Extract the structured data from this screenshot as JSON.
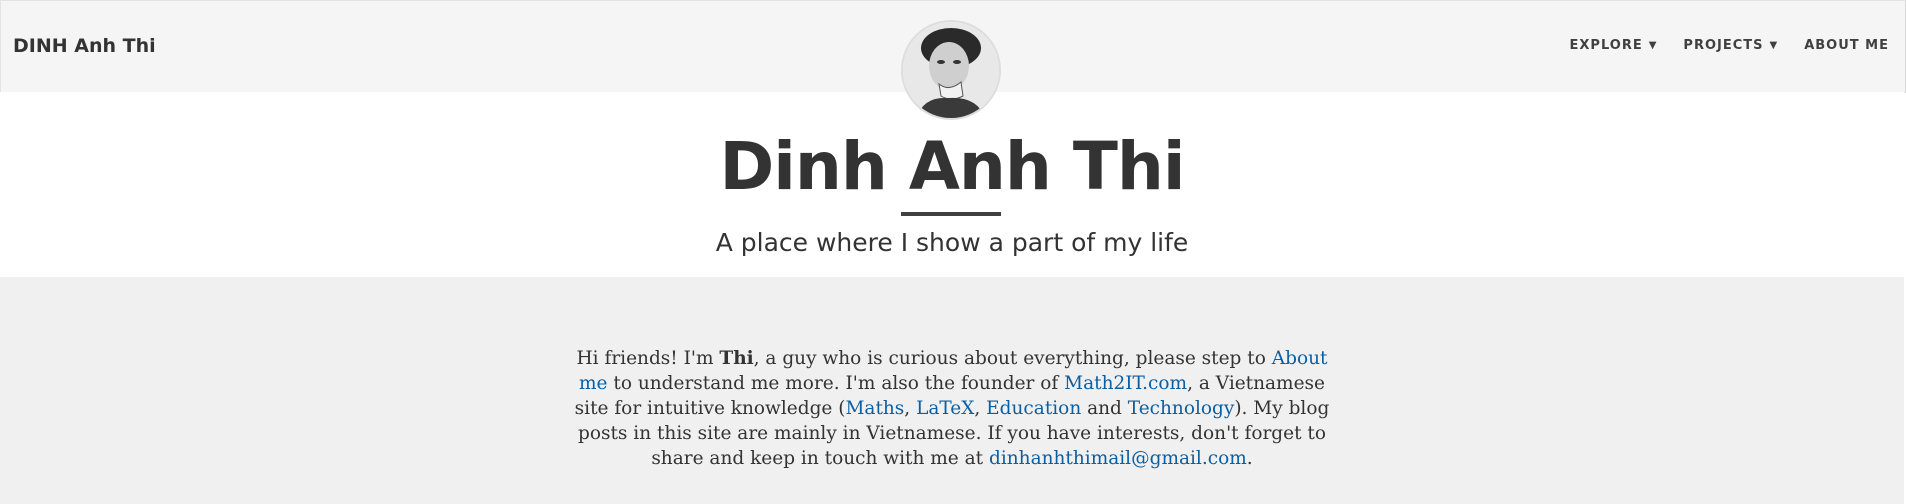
{
  "navbar": {
    "brand": "DINH Anh Thi",
    "links": [
      {
        "label": "EXPLORE",
        "caret": "▼"
      },
      {
        "label": "PROJECTS",
        "caret": "▼"
      },
      {
        "label": "ABOUT ME",
        "caret": ""
      }
    ]
  },
  "header": {
    "title": "Dinh Anh Thi",
    "subtitle": "A place where I show a part of my life"
  },
  "intro": {
    "t1": "Hi friends! I'm ",
    "name": "Thi",
    "t2": ", a guy who is curious about everything, please step to ",
    "about_link": "About me",
    "t3": " to understand me more. I'm also the founder of ",
    "site_link": "Math2IT.com",
    "t4": ", a Vietnamese site for intuitive knowledge (",
    "maths_link": "Maths",
    "sep1": ", ",
    "latex_link": "LaTeX",
    "sep2": ", ",
    "education_link": "Education",
    "t5": " and ",
    "technology_link": "Technology",
    "t6": "). My blog posts in this site are mainly in Vietnamese. If you have interests, don't forget to share and keep in touch with me at ",
    "email_link": "dinhanhthimail@gmail.com",
    "t7": "."
  },
  "colors": {
    "link": "#0a5fa3",
    "navbar_bg": "#f5f5f5",
    "main_bg": "#f0f0f0",
    "text": "#333333"
  },
  "icons": {
    "avatar": "avatar-photo"
  }
}
